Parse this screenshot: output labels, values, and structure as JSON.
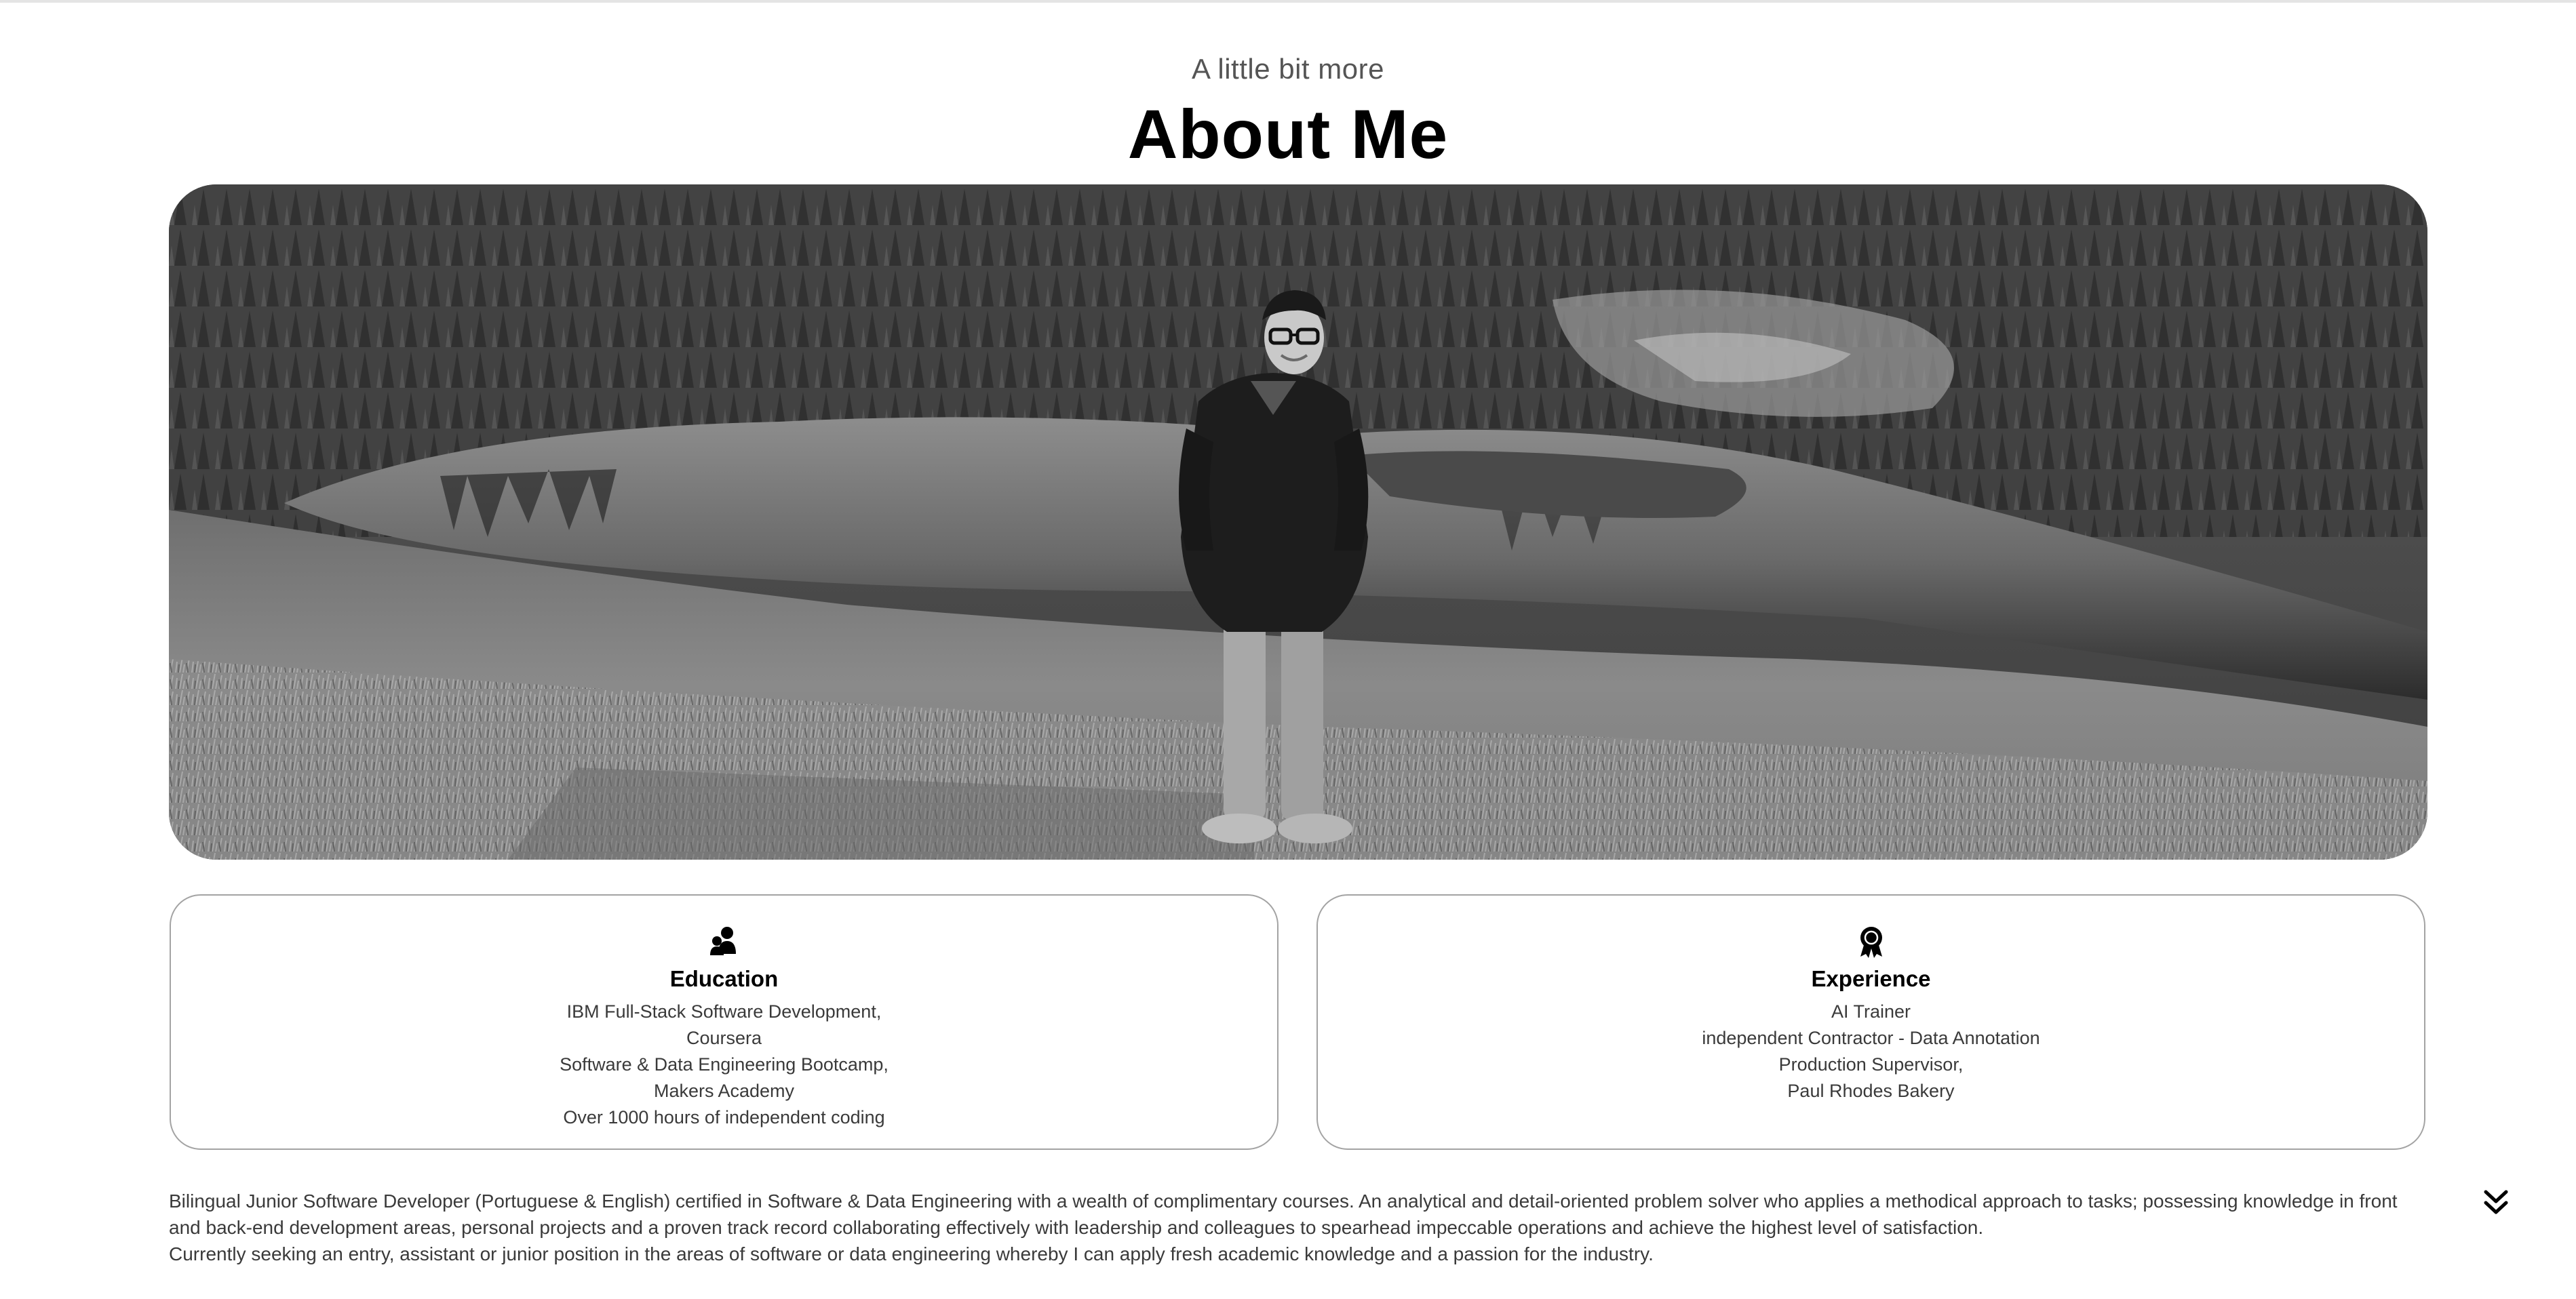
{
  "about": {
    "subtitle": "A little bit more",
    "title": "About Me"
  },
  "hero_image": {
    "alt": "Man wearing glasses and a dark jacket standing on a grassy hill above a forest lake, black and white photo",
    "filter": "grayscale"
  },
  "cards": {
    "education": {
      "icon": "people-icon",
      "title": "Education",
      "lines": [
        "IBM Full-Stack Software Development,",
        "Coursera",
        "Software & Data Engineering Bootcamp,",
        "Makers Academy",
        "Over 1000 hours of independent coding"
      ]
    },
    "experience": {
      "icon": "award-icon",
      "title": "Experience",
      "lines": [
        "AI Trainer",
        "independent Contractor - Data Annotation",
        "Production Supervisor,",
        "Paul Rhodes Bakery"
      ]
    }
  },
  "bio": {
    "paragraph1": "Bilingual Junior Software Developer (Portuguese & English) certified in Software & Data Engineering with a wealth of complimentary courses. An analytical and detail-oriented problem solver who applies a methodical approach to tasks; possessing knowledge in front and back-end development areas, personal projects and a proven track record collaborating effectively with leadership and colleagues to spearhead impeccable operations and achieve the highest level of satisfaction.",
    "paragraph2": "Currently seeking an entry, assistant or junior position in the areas of software or data engineering whereby I can apply fresh academic knowledge and a passion for the industry."
  },
  "scroll_button": {
    "icon": "double-chevron-down-icon"
  }
}
